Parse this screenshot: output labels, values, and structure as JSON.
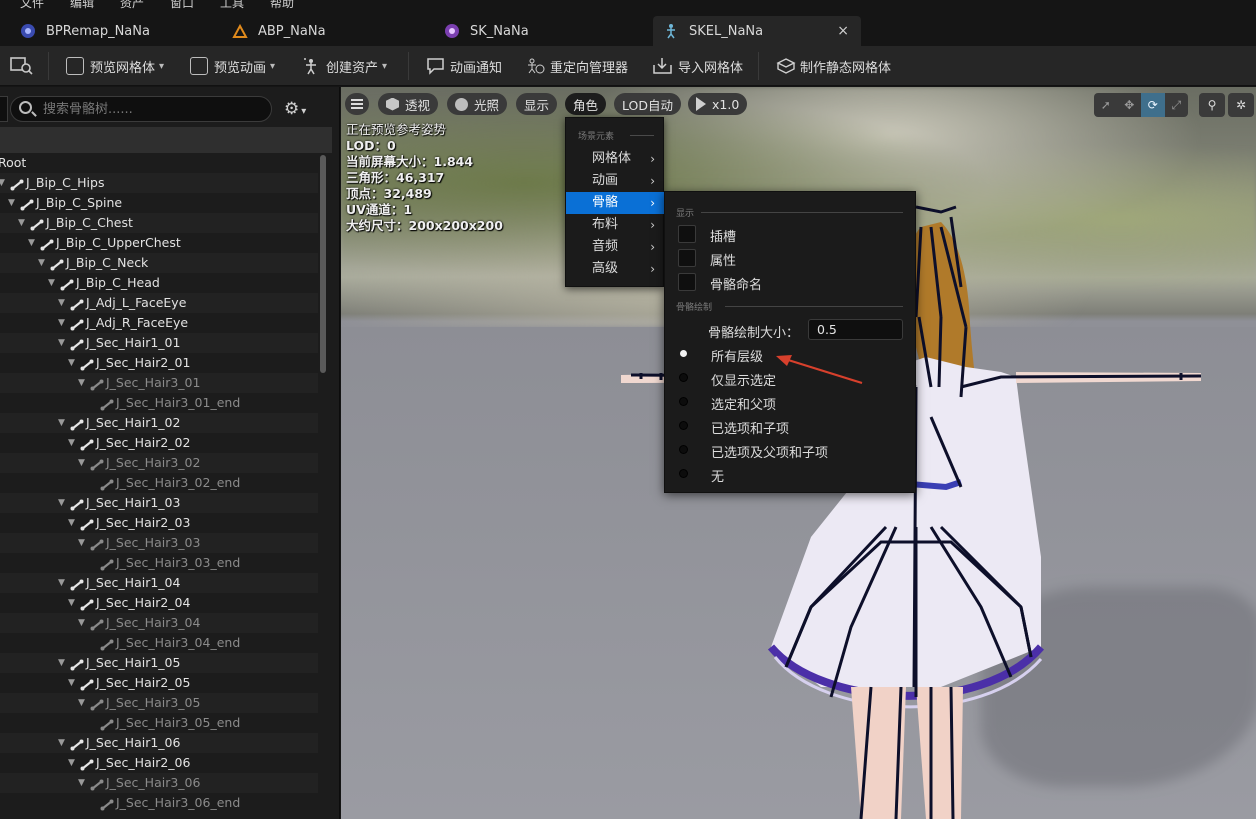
{
  "menubar": {
    "items": [
      "文件",
      "编辑",
      "资产",
      "窗口",
      "工具",
      "帮助"
    ]
  },
  "tabs": [
    {
      "label": "BPRemap_NaNa",
      "icon": "blueprint-icon",
      "active": false
    },
    {
      "label": "ABP_NaNa",
      "icon": "anim-blueprint-icon",
      "active": false
    },
    {
      "label": "SK_NaNa",
      "icon": "skeletal-mesh-icon",
      "active": false
    },
    {
      "label": "SKEL_NaNa",
      "icon": "skeleton-icon",
      "active": true,
      "close": "×"
    }
  ],
  "toolbar": {
    "preview_mesh": "预览网格体",
    "preview_anim": "预览动画",
    "create_asset": "创建资产",
    "anim_notify": "动画通知",
    "retarget_manager": "重定向管理器",
    "import_mesh": "导入网格体",
    "make_static_mesh": "制作静态网格体"
  },
  "skeleton_tree": {
    "search_placeholder": "搜索骨骼树......",
    "rows": [
      {
        "label": "Root",
        "depth": 0,
        "dim": false
      },
      {
        "label": "J_Bip_C_Hips",
        "depth": 1,
        "dim": false
      },
      {
        "label": "J_Bip_C_Spine",
        "depth": 2,
        "dim": false
      },
      {
        "label": "J_Bip_C_Chest",
        "depth": 3,
        "dim": false
      },
      {
        "label": "J_Bip_C_UpperChest",
        "depth": 4,
        "dim": false
      },
      {
        "label": "J_Bip_C_Neck",
        "depth": 5,
        "dim": false
      },
      {
        "label": "J_Bip_C_Head",
        "depth": 6,
        "dim": false
      },
      {
        "label": "J_Adj_L_FaceEye",
        "depth": 7,
        "dim": false
      },
      {
        "label": "J_Adj_R_FaceEye",
        "depth": 7,
        "dim": false
      },
      {
        "label": "J_Sec_Hair1_01",
        "depth": 7,
        "dim": false
      },
      {
        "label": "J_Sec_Hair2_01",
        "depth": 8,
        "dim": false
      },
      {
        "label": "J_Sec_Hair3_01",
        "depth": 9,
        "dim": true
      },
      {
        "label": "J_Sec_Hair3_01_end",
        "depth": 10,
        "dim": true
      },
      {
        "label": "J_Sec_Hair1_02",
        "depth": 7,
        "dim": false
      },
      {
        "label": "J_Sec_Hair2_02",
        "depth": 8,
        "dim": false
      },
      {
        "label": "J_Sec_Hair3_02",
        "depth": 9,
        "dim": true
      },
      {
        "label": "J_Sec_Hair3_02_end",
        "depth": 10,
        "dim": true
      },
      {
        "label": "J_Sec_Hair1_03",
        "depth": 7,
        "dim": false
      },
      {
        "label": "J_Sec_Hair2_03",
        "depth": 8,
        "dim": false
      },
      {
        "label": "J_Sec_Hair3_03",
        "depth": 9,
        "dim": true
      },
      {
        "label": "J_Sec_Hair3_03_end",
        "depth": 10,
        "dim": true
      },
      {
        "label": "J_Sec_Hair1_04",
        "depth": 7,
        "dim": false
      },
      {
        "label": "J_Sec_Hair2_04",
        "depth": 8,
        "dim": false
      },
      {
        "label": "J_Sec_Hair3_04",
        "depth": 9,
        "dim": true
      },
      {
        "label": "J_Sec_Hair3_04_end",
        "depth": 10,
        "dim": true
      },
      {
        "label": "J_Sec_Hair1_05",
        "depth": 7,
        "dim": false
      },
      {
        "label": "J_Sec_Hair2_05",
        "depth": 8,
        "dim": false
      },
      {
        "label": "J_Sec_Hair3_05",
        "depth": 9,
        "dim": true
      },
      {
        "label": "J_Sec_Hair3_05_end",
        "depth": 10,
        "dim": true
      },
      {
        "label": "J_Sec_Hair1_06",
        "depth": 7,
        "dim": false
      },
      {
        "label": "J_Sec_Hair2_06",
        "depth": 8,
        "dim": false
      },
      {
        "label": "J_Sec_Hair3_06",
        "depth": 9,
        "dim": true
      },
      {
        "label": "J_Sec_Hair3_06_end",
        "depth": 10,
        "dim": true
      }
    ]
  },
  "viewport": {
    "buttons": {
      "perspective": "透视",
      "lighting": "光照",
      "show": "显示",
      "character": "角色",
      "lod": "LOD自动",
      "play_speed": "x1.0"
    },
    "stats": [
      "正在预览参考姿势",
      "LOD：0",
      "当前屏幕大小：1.844",
      "三角形：46,317",
      "顶点：32,489",
      "UV通道：1",
      "大约尺寸：200x200x200"
    ]
  },
  "character_menu": {
    "section": "场景元素",
    "items": [
      {
        "label": "网格体",
        "selected": false
      },
      {
        "label": "动画",
        "selected": false
      },
      {
        "label": "骨骼",
        "selected": true
      },
      {
        "label": "布料",
        "selected": false
      },
      {
        "label": "音频",
        "selected": false
      },
      {
        "label": "高级",
        "selected": false
      }
    ],
    "submenu_glyph": "›"
  },
  "bone_submenu": {
    "display_section": "显示",
    "checkboxes": [
      {
        "label": "插槽",
        "checked": false
      },
      {
        "label": "属性",
        "checked": false
      },
      {
        "label": "骨骼命名",
        "checked": false
      }
    ],
    "draw_section": "骨骼绘制",
    "draw_size_label": "骨骼绘制大小：",
    "draw_size_value": "0.5",
    "radios": [
      {
        "label": "所有层级",
        "selected": true
      },
      {
        "label": "仅显示选定",
        "selected": false
      },
      {
        "label": "选定和父项",
        "selected": false
      },
      {
        "label": "已选项和子项",
        "selected": false
      },
      {
        "label": "已选项及父项和子项",
        "selected": false
      },
      {
        "label": "无",
        "selected": false
      }
    ]
  },
  "colors": {
    "accent": "#0a70d6",
    "annotation_arrow": "#d7402c",
    "skeleton_lines": "#0d0f2a"
  }
}
